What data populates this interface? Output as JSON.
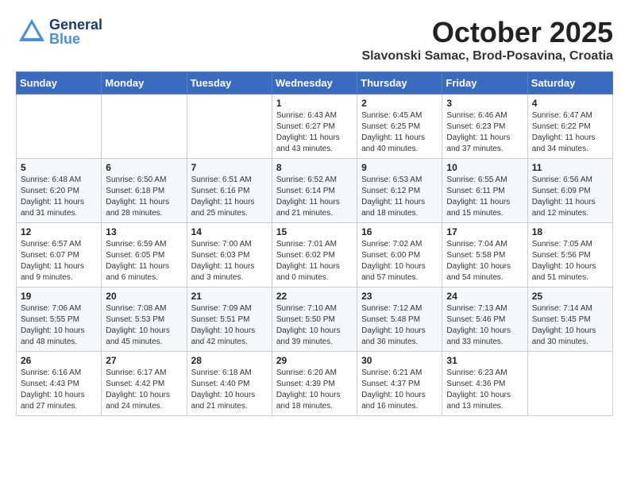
{
  "header": {
    "logo_general": "General",
    "logo_blue": "Blue",
    "month": "October 2025",
    "location": "Slavonski Samac, Brod-Posavina, Croatia"
  },
  "calendar": {
    "weekdays": [
      "Sunday",
      "Monday",
      "Tuesday",
      "Wednesday",
      "Thursday",
      "Friday",
      "Saturday"
    ],
    "weeks": [
      [
        {
          "day": "",
          "info": ""
        },
        {
          "day": "",
          "info": ""
        },
        {
          "day": "",
          "info": ""
        },
        {
          "day": "1",
          "info": "Sunrise: 6:43 AM\nSunset: 6:27 PM\nDaylight: 11 hours\nand 43 minutes."
        },
        {
          "day": "2",
          "info": "Sunrise: 6:45 AM\nSunset: 6:25 PM\nDaylight: 11 hours\nand 40 minutes."
        },
        {
          "day": "3",
          "info": "Sunrise: 6:46 AM\nSunset: 6:23 PM\nDaylight: 11 hours\nand 37 minutes."
        },
        {
          "day": "4",
          "info": "Sunrise: 6:47 AM\nSunset: 6:22 PM\nDaylight: 11 hours\nand 34 minutes."
        }
      ],
      [
        {
          "day": "5",
          "info": "Sunrise: 6:48 AM\nSunset: 6:20 PM\nDaylight: 11 hours\nand 31 minutes."
        },
        {
          "day": "6",
          "info": "Sunrise: 6:50 AM\nSunset: 6:18 PM\nDaylight: 11 hours\nand 28 minutes."
        },
        {
          "day": "7",
          "info": "Sunrise: 6:51 AM\nSunset: 6:16 PM\nDaylight: 11 hours\nand 25 minutes."
        },
        {
          "day": "8",
          "info": "Sunrise: 6:52 AM\nSunset: 6:14 PM\nDaylight: 11 hours\nand 21 minutes."
        },
        {
          "day": "9",
          "info": "Sunrise: 6:53 AM\nSunset: 6:12 PM\nDaylight: 11 hours\nand 18 minutes."
        },
        {
          "day": "10",
          "info": "Sunrise: 6:55 AM\nSunset: 6:11 PM\nDaylight: 11 hours\nand 15 minutes."
        },
        {
          "day": "11",
          "info": "Sunrise: 6:56 AM\nSunset: 6:09 PM\nDaylight: 11 hours\nand 12 minutes."
        }
      ],
      [
        {
          "day": "12",
          "info": "Sunrise: 6:57 AM\nSunset: 6:07 PM\nDaylight: 11 hours\nand 9 minutes."
        },
        {
          "day": "13",
          "info": "Sunrise: 6:59 AM\nSunset: 6:05 PM\nDaylight: 11 hours\nand 6 minutes."
        },
        {
          "day": "14",
          "info": "Sunrise: 7:00 AM\nSunset: 6:03 PM\nDaylight: 11 hours\nand 3 minutes."
        },
        {
          "day": "15",
          "info": "Sunrise: 7:01 AM\nSunset: 6:02 PM\nDaylight: 11 hours\nand 0 minutes."
        },
        {
          "day": "16",
          "info": "Sunrise: 7:02 AM\nSunset: 6:00 PM\nDaylight: 10 hours\nand 57 minutes."
        },
        {
          "day": "17",
          "info": "Sunrise: 7:04 AM\nSunset: 5:58 PM\nDaylight: 10 hours\nand 54 minutes."
        },
        {
          "day": "18",
          "info": "Sunrise: 7:05 AM\nSunset: 5:56 PM\nDaylight: 10 hours\nand 51 minutes."
        }
      ],
      [
        {
          "day": "19",
          "info": "Sunrise: 7:06 AM\nSunset: 5:55 PM\nDaylight: 10 hours\nand 48 minutes."
        },
        {
          "day": "20",
          "info": "Sunrise: 7:08 AM\nSunset: 5:53 PM\nDaylight: 10 hours\nand 45 minutes."
        },
        {
          "day": "21",
          "info": "Sunrise: 7:09 AM\nSunset: 5:51 PM\nDaylight: 10 hours\nand 42 minutes."
        },
        {
          "day": "22",
          "info": "Sunrise: 7:10 AM\nSunset: 5:50 PM\nDaylight: 10 hours\nand 39 minutes."
        },
        {
          "day": "23",
          "info": "Sunrise: 7:12 AM\nSunset: 5:48 PM\nDaylight: 10 hours\nand 36 minutes."
        },
        {
          "day": "24",
          "info": "Sunrise: 7:13 AM\nSunset: 5:46 PM\nDaylight: 10 hours\nand 33 minutes."
        },
        {
          "day": "25",
          "info": "Sunrise: 7:14 AM\nSunset: 5:45 PM\nDaylight: 10 hours\nand 30 minutes."
        }
      ],
      [
        {
          "day": "26",
          "info": "Sunrise: 6:16 AM\nSunset: 4:43 PM\nDaylight: 10 hours\nand 27 minutes."
        },
        {
          "day": "27",
          "info": "Sunrise: 6:17 AM\nSunset: 4:42 PM\nDaylight: 10 hours\nand 24 minutes."
        },
        {
          "day": "28",
          "info": "Sunrise: 6:18 AM\nSunset: 4:40 PM\nDaylight: 10 hours\nand 21 minutes."
        },
        {
          "day": "29",
          "info": "Sunrise: 6:20 AM\nSunset: 4:39 PM\nDaylight: 10 hours\nand 18 minutes."
        },
        {
          "day": "30",
          "info": "Sunrise: 6:21 AM\nSunset: 4:37 PM\nDaylight: 10 hours\nand 16 minutes."
        },
        {
          "day": "31",
          "info": "Sunrise: 6:23 AM\nSunset: 4:36 PM\nDaylight: 10 hours\nand 13 minutes."
        },
        {
          "day": "",
          "info": ""
        }
      ]
    ]
  }
}
